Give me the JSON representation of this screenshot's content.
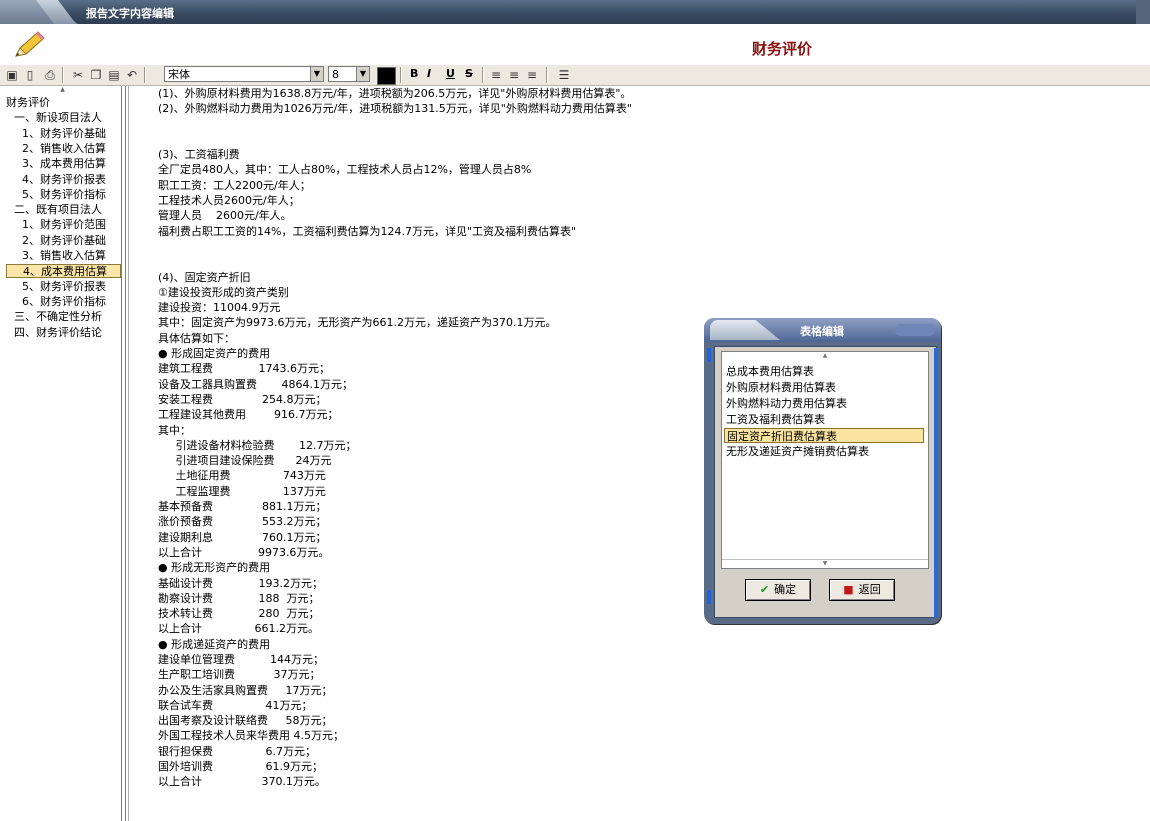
{
  "window": {
    "title": "报告文字内容编辑"
  },
  "document": {
    "title": "财务评价"
  },
  "toolbar": {
    "font_value": "宋体",
    "size_value": "8",
    "text_color": "#000000",
    "bold_label": "B",
    "italic_label": "I",
    "underline_label": "U",
    "strike_label": "S"
  },
  "sidebar": {
    "items": [
      {
        "label": "财务评价",
        "indent": 0
      },
      {
        "label": "一、新设项目法人",
        "indent": 1
      },
      {
        "label": "1、财务评价基础",
        "indent": 2
      },
      {
        "label": "2、销售收入估算",
        "indent": 2
      },
      {
        "label": "3、成本费用估算",
        "indent": 2
      },
      {
        "label": "4、财务评价报表",
        "indent": 2
      },
      {
        "label": "5、财务评价指标",
        "indent": 2
      },
      {
        "label": "二、既有项目法人",
        "indent": 1
      },
      {
        "label": "1、财务评价范围",
        "indent": 2
      },
      {
        "label": "2、财务评价基础",
        "indent": 2
      },
      {
        "label": "3、销售收入估算",
        "indent": 2
      },
      {
        "label": "4、成本费用估算",
        "indent": 2,
        "selected": true
      },
      {
        "label": "5、财务评价报表",
        "indent": 2
      },
      {
        "label": "6、财务评价指标",
        "indent": 2
      },
      {
        "label": "三、不确定性分析",
        "indent": 1
      },
      {
        "label": "四、财务评价结论",
        "indent": 1
      }
    ]
  },
  "content": {
    "lines": [
      "(1)、外购原材料费用为1638.8万元/年，进项税额为206.5万元，详见\"外购原材料费用估算表\"。",
      "(2)、外购燃料动力费用为1026万元/年，进项税额为131.5万元，详见\"外购燃料动力费用估算表\"",
      "",
      "",
      "(3)、工资福利费",
      "全厂定员480人，其中：工人占80%，工程技术人员占12%，管理人员占8%",
      "职工工资：工人2200元/年人；",
      "工程技术人员2600元/年人；",
      "管理人员    2600元/年人。",
      "福利费占职工工资的14%，工资福利费估算为124.7万元，详见\"工资及福利费估算表\"",
      "",
      "",
      "(4)、固定资产折旧",
      "①建设投资形成的资产类别",
      "建设投资：11004.9万元",
      "其中：固定资产为9973.6万元，无形资产为661.2万元，递延资产为370.1万元。",
      "具体估算如下：",
      "● 形成固定资产的费用",
      "建筑工程费             1743.6万元；",
      "设备及工器具购置费       4864.1万元；",
      "安装工程费              254.8万元；",
      "工程建设其他费用        916.7万元；",
      "其中：",
      "     引进设备材料检验费       12.7万元；",
      "     引进项目建设保险费      24万元",
      "     土地征用费               743万元",
      "     工程监理费               137万元",
      "基本预备费              881.1万元；",
      "涨价预备费              553.2万元；",
      "建设期利息              760.1万元；",
      "以上合计                9973.6万元。",
      "● 形成无形资产的费用",
      "基础设计费             193.2万元；",
      "勘察设计费             188  万元；",
      "技术转让费             280  万元；",
      "以上合计               661.2万元。",
      "● 形成递延资产的费用",
      "建设单位管理费          144万元；",
      "生产职工培训费           37万元；",
      "办公及生活家具购置费     17万元；",
      "联合试车费               41万元；",
      "出国考察及设计联络费     58万元；",
      "外国工程技术人员来华费用 4.5万元；",
      "银行担保费               6.7万元；",
      "国外培训费               61.9万元；",
      "以上合计                 370.1万元。"
    ]
  },
  "dialog": {
    "title": "表格编辑",
    "items": [
      {
        "label": "总成本费用估算表"
      },
      {
        "label": "外购原材料费用估算表"
      },
      {
        "label": "外购燃料动力费用估算表"
      },
      {
        "label": "工资及福利费估算表"
      },
      {
        "label": "固定资产折旧费估算表",
        "selected": true
      },
      {
        "label": "无形及递延资产摊销费估算表"
      }
    ],
    "ok_label": "确定",
    "back_label": "返回"
  }
}
